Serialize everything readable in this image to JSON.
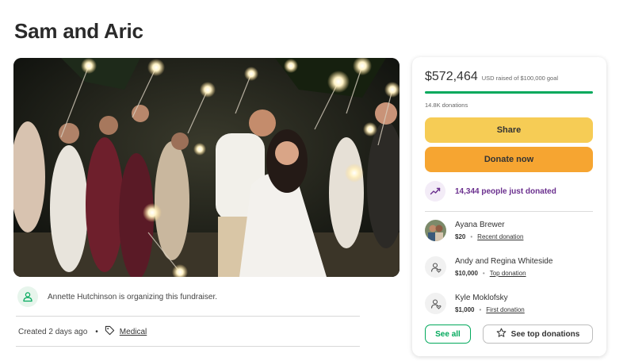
{
  "page": {
    "title": "Sam and Aric"
  },
  "organizer": {
    "icon": "person-heart-icon",
    "text": "Annette Hutchinson is organizing this fundraiser."
  },
  "meta": {
    "created": "Created 2 days ago",
    "separator": "•",
    "tag_icon": "tag-icon",
    "category": "Medical"
  },
  "card": {
    "raised_amount": "$572,464",
    "raised_goal": "USD raised of $100,000 goal",
    "progress_fraction": 1.0,
    "donation_count": "14.8K donations",
    "share_label": "Share",
    "donate_label": "Donate now",
    "trend_icon": "trending-up-icon",
    "trend_text": "14,344 people just donated",
    "donors": [
      {
        "name": "Ayana Brewer",
        "amount": "$20",
        "type": "Recent donation",
        "avatar": "photo"
      },
      {
        "name": "Andy and Regina Whiteside",
        "amount": "$10,000",
        "type": "Top donation",
        "avatar": "person-heart-icon"
      },
      {
        "name": "Kyle Moklofsky",
        "amount": "$1,000",
        "type": "First donation",
        "avatar": "person-heart-icon"
      }
    ],
    "donor_separator": "•",
    "see_all_label": "See all",
    "see_top_label": "See top donations",
    "star_icon": "star-icon"
  },
  "colors": {
    "brand_green": "#02a95c",
    "share_yellow": "#f6cc55",
    "donate_orange": "#f6a531",
    "trend_purple": "#6a2f8e"
  }
}
